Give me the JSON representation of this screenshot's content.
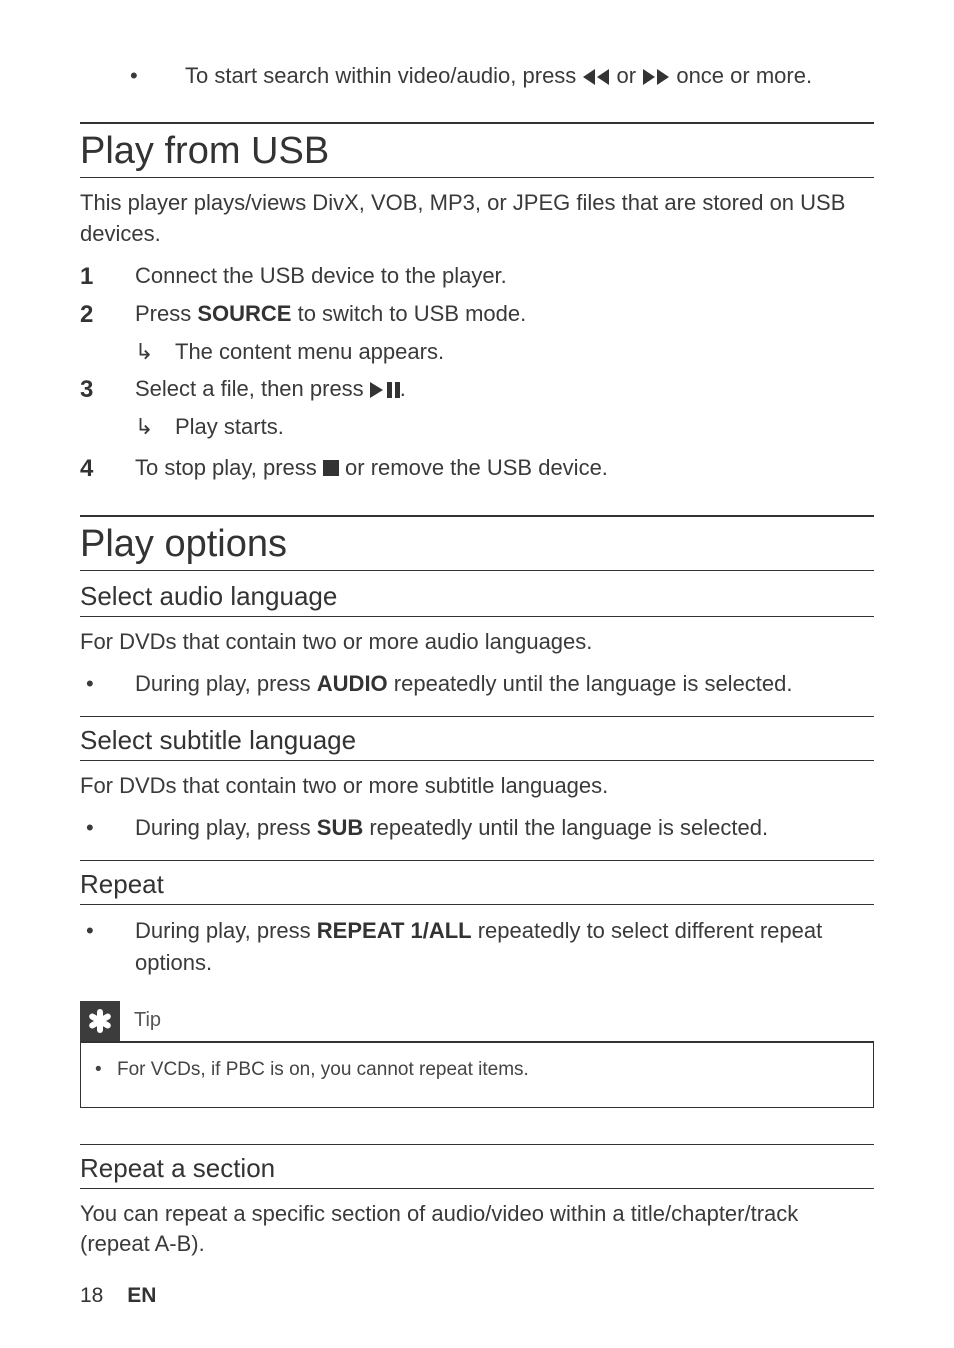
{
  "top_bullet": {
    "pre": "To start search within video/audio, press ",
    "mid": " or ",
    "post": " once or more."
  },
  "usb": {
    "heading": "Play from USB",
    "intro": "This player plays/views DivX, VOB, MP3, or JPEG files that are stored on USB devices.",
    "s1_num": "1",
    "s1": "Connect the USB device to the player.",
    "s2_num": "2",
    "s2_pre": "Press ",
    "s2_bold": "SOURCE",
    "s2_post": " to switch to USB mode.",
    "s2_sub": "The content menu appears.",
    "s3_num": "3",
    "s3_pre": "Select a file, then press ",
    "s3_post": ".",
    "s3_sub": "Play starts.",
    "s4_num": "4",
    "s4_pre": "To stop play, press ",
    "s4_post": " or remove the USB device."
  },
  "opts": {
    "heading": "Play options",
    "audio_h": "Select audio language",
    "audio_intro": "For DVDs that contain two or more audio languages.",
    "audio_b_pre": "During play, press ",
    "audio_b_bold": "AUDIO",
    "audio_b_post": " repeatedly until the language is selected.",
    "sub_h": "Select subtitle language",
    "sub_intro": "For DVDs that contain two or more subtitle languages.",
    "sub_b_pre": "During play, press ",
    "sub_b_bold": "SUB",
    "sub_b_post": " repeatedly until the language is selected.",
    "repeat_h": "Repeat",
    "repeat_b_pre": "During play, press ",
    "repeat_b_bold": "REPEAT 1/ALL",
    "repeat_b_post": " repeatedly to select different repeat options.",
    "tip_label": "Tip",
    "tip_text": "For VCDs, if PBC is on, you cannot repeat items.",
    "rsection_h": "Repeat a section",
    "rsection_intro": "You can repeat a specific section of audio/video within a title/chapter/track (repeat A-B)."
  },
  "footer": {
    "page": "18",
    "lang": "EN"
  }
}
